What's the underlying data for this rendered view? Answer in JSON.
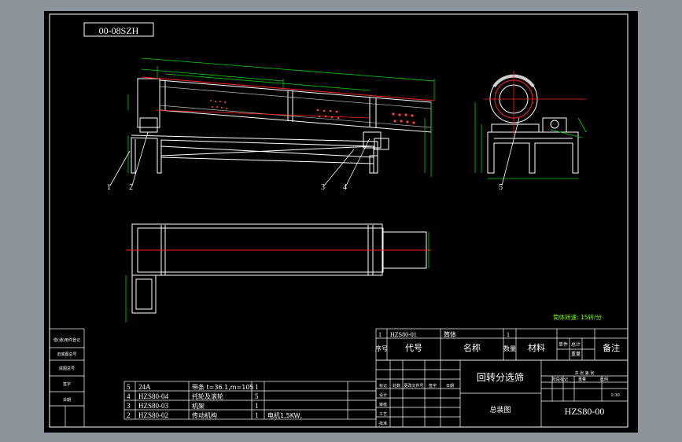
{
  "drawing": {
    "stamp_code": "00-08SZH",
    "drawing_number": "HZS80-00",
    "title": "回转分选筛",
    "view_name": "总装图",
    "scale": "1:30",
    "capacity_note": "筒体转速: 15转/分"
  },
  "balloons": [
    "1",
    "2",
    "3",
    "4",
    "5"
  ],
  "parts_table": {
    "headers": [
      "序号",
      "代号",
      "名称",
      "数量",
      "材料",
      "单件",
      "总计",
      "重量",
      "备注"
    ],
    "top_row": {
      "no": "1",
      "code": "HZS80-01",
      "name": "筒体",
      "qty": "1"
    },
    "rows": [
      {
        "no": "5",
        "code": "24A",
        "name": "带条 t=36.1,m=105",
        "qty": "1",
        "note": ""
      },
      {
        "no": "4",
        "code": "HZS80-04",
        "name": "托轮及滚轮",
        "qty": "5",
        "note": ""
      },
      {
        "no": "3",
        "code": "HZS80-03",
        "name": "机架",
        "qty": "1",
        "note": ""
      },
      {
        "no": "2",
        "code": "HZS80-02",
        "name": "传动机构",
        "qty": "1",
        "note": "电机1.5KW,"
      }
    ]
  },
  "title_block": {
    "col_labels": [
      "标记",
      "处数",
      "更改文件号",
      "签字",
      "日期"
    ],
    "role_labels": [
      "设计",
      "审核",
      "工艺",
      "批准"
    ],
    "stage_labels": [
      "阶段标记",
      "重量",
      "比例"
    ],
    "sheet_label": "共 张 第 张"
  },
  "left_strip": [
    "借(通)用件登记",
    "旧底图总号",
    "底图总号",
    "签字",
    "日期"
  ],
  "colors": {
    "background": "#000000",
    "frame": "#ffffff",
    "dimension": "#00ff00",
    "centerline": "#ff2020",
    "window": "#8d939b"
  }
}
